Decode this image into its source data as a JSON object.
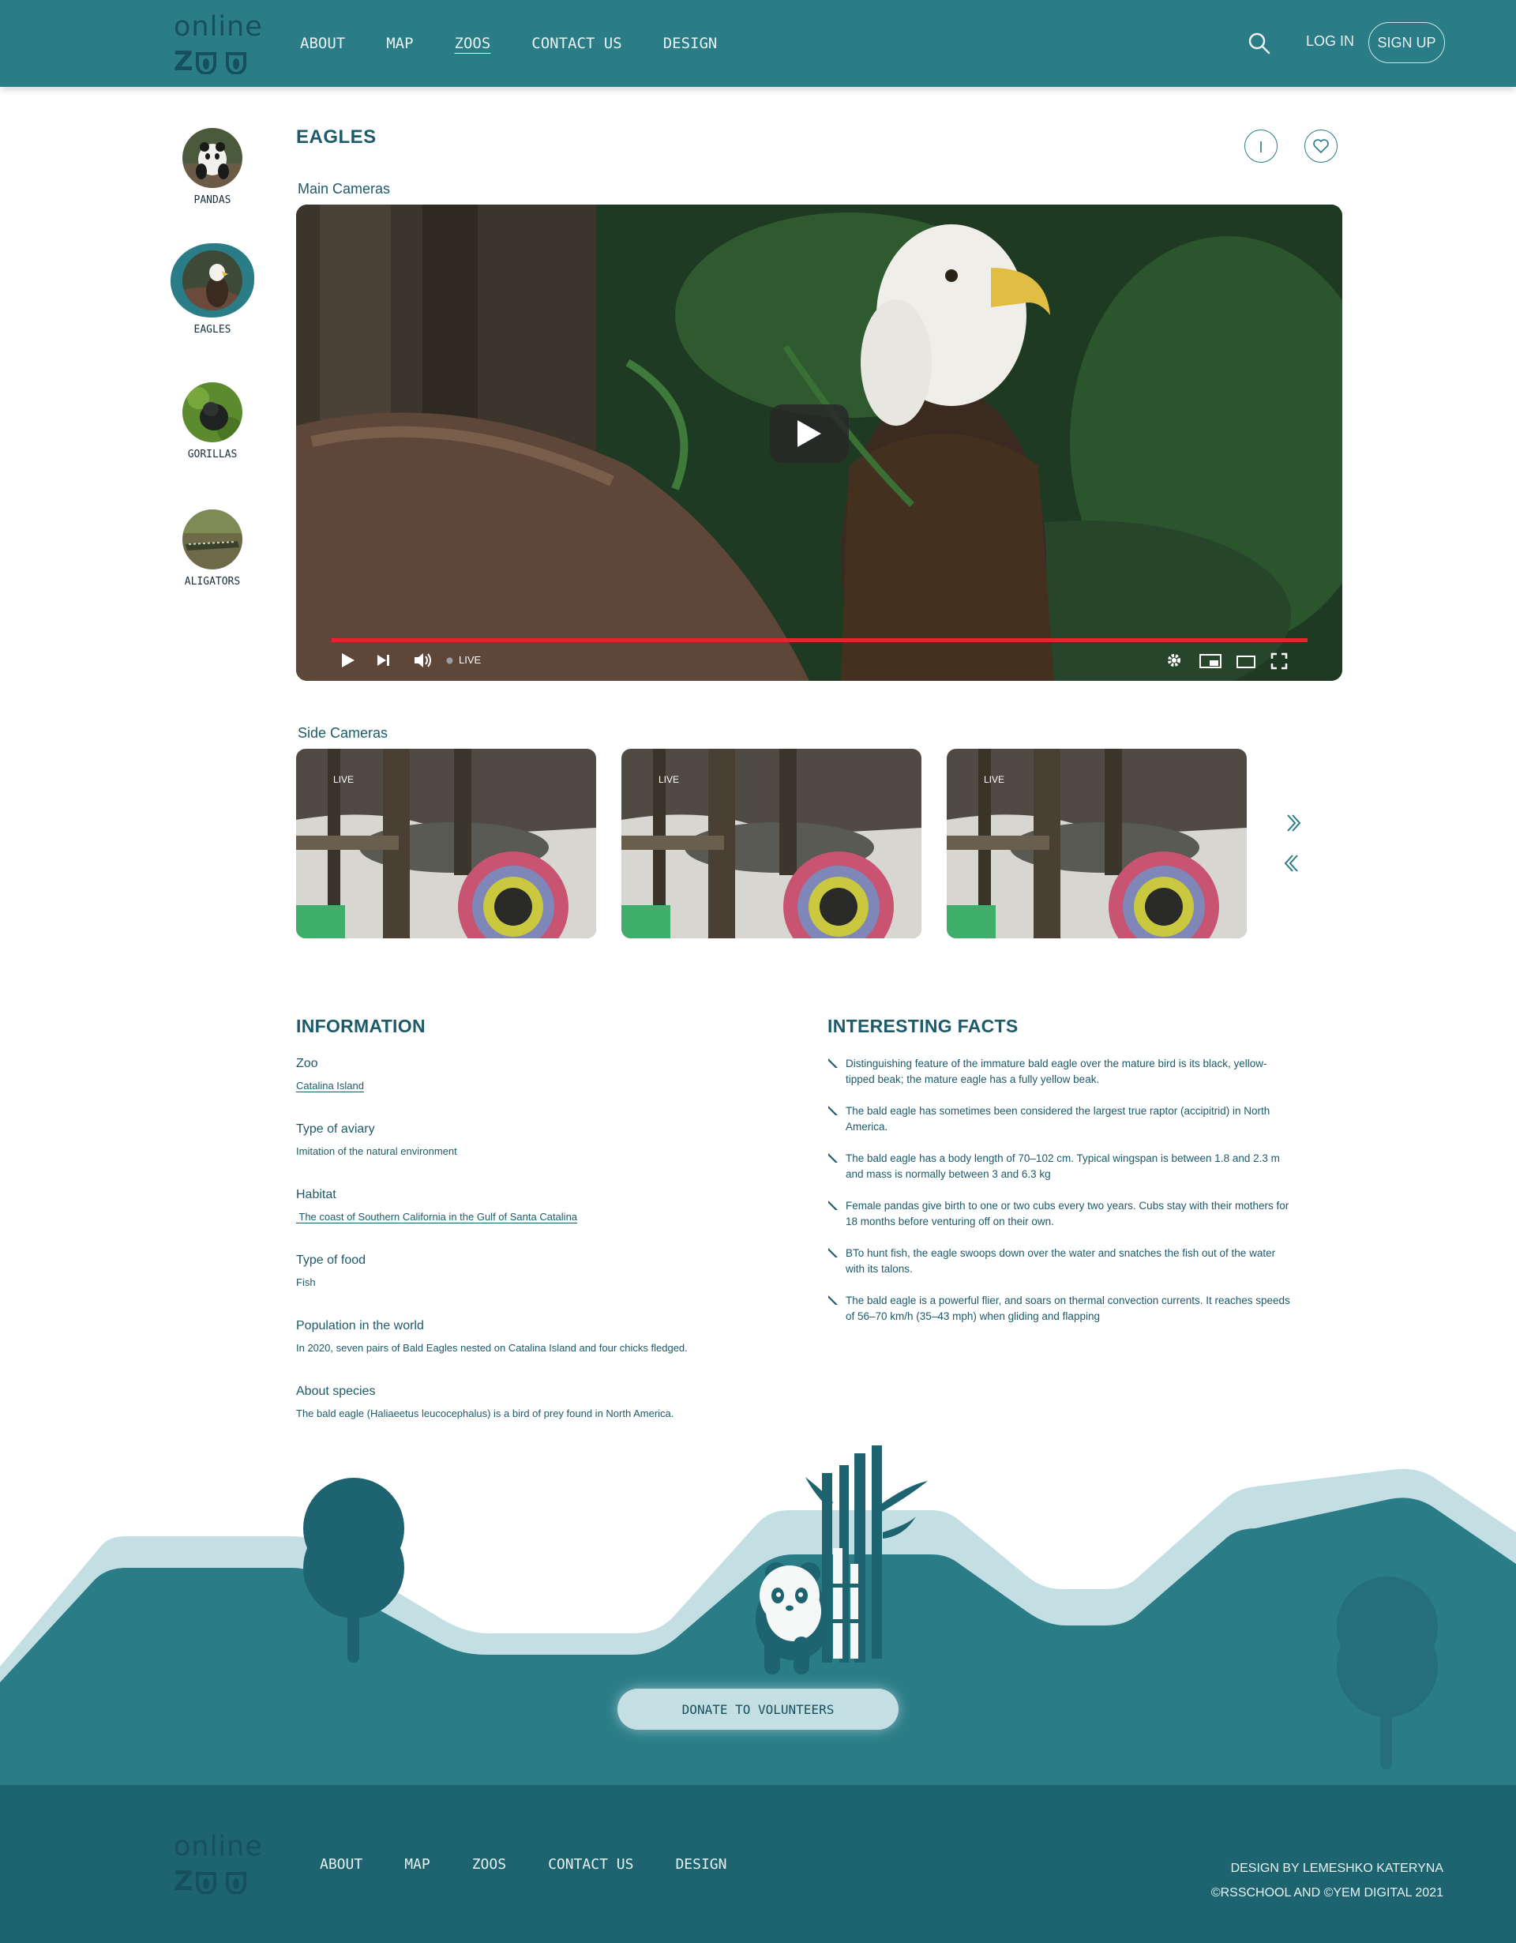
{
  "header": {
    "logo": {
      "word": "online",
      "z": "Z"
    },
    "nav": [
      "ABOUT",
      "MAP",
      "ZOOS",
      "CONTACT US",
      "DESIGN"
    ],
    "active_nav": "ZOOS",
    "login": "LOG IN",
    "signup": "SIGN UP"
  },
  "sidebar": {
    "items": [
      {
        "label": "PANDAS",
        "icon": "panda-avatar"
      },
      {
        "label": "EAGLES",
        "icon": "eagle-avatar",
        "active": true
      },
      {
        "label": "GORILLAS",
        "icon": "gorilla-avatar"
      },
      {
        "label": "ALIGATORS",
        "icon": "alligator-avatar"
      }
    ]
  },
  "page": {
    "title": "EAGLES",
    "main_cameras_label": "Main Cameras",
    "side_cameras_label": "Side Cameras",
    "live": "LIVE",
    "side_cams": [
      {
        "live": "LIVE"
      },
      {
        "live": "LIVE"
      },
      {
        "live": "LIVE"
      }
    ]
  },
  "information": {
    "title": "INFORMATION",
    "items": [
      {
        "label": "Zoo",
        "value": "Catalina Island"
      },
      {
        "label": "Type of aviary",
        "value": "Imitation of the natural environment"
      },
      {
        "label": "Habitat",
        "value": " The coast of Southern California in the Gulf of Santa Catalina"
      },
      {
        "label": "Type of food",
        "value": "Fish"
      },
      {
        "label": "Population in the world",
        "value": "In 2020, seven pairs of Bald Eagles nested on Catalina Island and four chicks fledged."
      },
      {
        "label": "About species",
        "value": "The bald eagle (Haliaeetus leucocephalus) is a bird of prey found in North America."
      }
    ]
  },
  "facts": {
    "title": "INTERESTING FACTS",
    "items": [
      "Distinguishing feature of the immature bald eagle over the mature bird is its black, yellow-tipped beak; the mature eagle has a fully yellow beak.",
      "The bald eagle has sometimes been considered the largest true raptor (accipitrid) in North America.",
      "The bald eagle has a body length of 70–102 cm. Typical wingspan is between 1.8 and 2.3 m and mass is normally between 3 and 6.3 kg",
      "Female pandas give birth to one or two cubs every two years. Cubs stay with their mothers for 18 months before venturing off on their own.",
      "BTo hunt fish, the eagle swoops down over the water and snatches the fish out of the water with its talons.",
      "The bald eagle is a powerful flier, and soars on thermal convection currents. It reaches speeds of 56–70 km/h (35–43 mph) when gliding and flapping"
    ]
  },
  "donate": "DONATE TO VOLUNTEERS",
  "footer": {
    "logo": {
      "word": "online",
      "z": "Z"
    },
    "nav": [
      "ABOUT",
      "MAP",
      "ZOOS",
      "CONTACT US",
      "DESIGN"
    ],
    "credit1": "DESIGN BY LEMESHKO KATERYNA",
    "credit2": "©RSSCHOOL AND ©YEM DIGITAL 2021"
  },
  "colors": {
    "primary": "#2a7c87",
    "dark": "#1d6470",
    "light": "#c4dfe3",
    "progress": "#e3262b"
  }
}
